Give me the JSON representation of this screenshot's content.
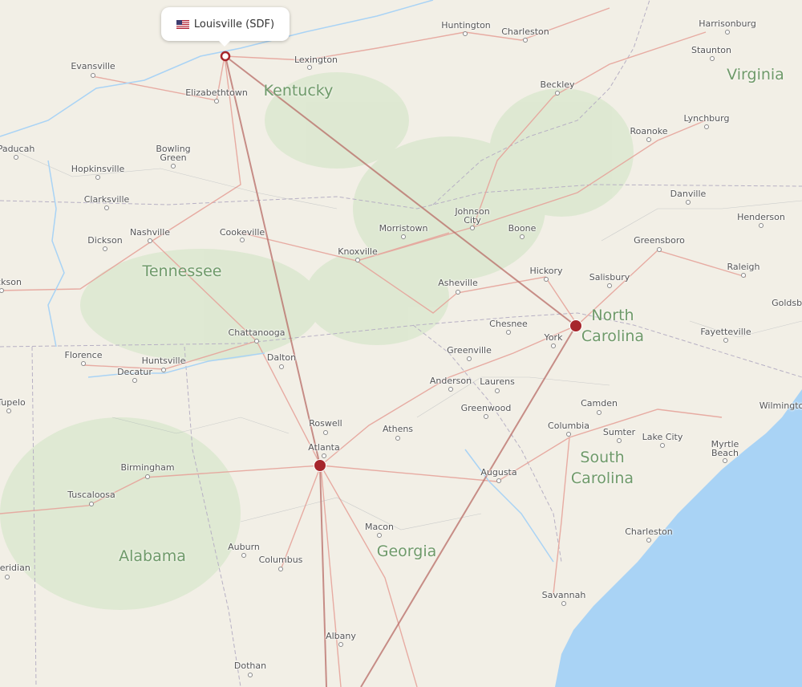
{
  "origin": {
    "label": "Louisville (SDF)",
    "flag": "us-flag-icon"
  },
  "colors": {
    "land": "#f2efe6",
    "water": "#a9d3f5",
    "route": "#b86c66",
    "airport": "#a6262c",
    "state_label": "#6f9a6a"
  },
  "states": [
    "Kentucky",
    "Tennessee",
    "Virginia",
    "North Carolina",
    "South Carolina",
    "Georgia",
    "Alabama"
  ],
  "cities": [
    "Evansville",
    "Louisville",
    "Lexington",
    "Huntington",
    "Charleston",
    "Harrisonburg",
    "Staunton",
    "Beckley",
    "Elizabethtown",
    "Paducah",
    "Bowling Green",
    "Hopkinsville",
    "Clarksville",
    "Roanoke",
    "Lynchburg",
    "Danville",
    "Johnson City",
    "Boone",
    "Morristown",
    "Knoxville",
    "Nashville",
    "Cookeville",
    "Dickson",
    "Henderson",
    "Greensboro",
    "Raleigh",
    "Goldsboro",
    "Hickory",
    "Salisbury",
    "Asheville",
    "Chesnee",
    "York",
    "Chattanooga",
    "Florence",
    "Huntsville",
    "Decatur",
    "Dalton",
    "Greenville",
    "Anderson",
    "Laurens",
    "Fayetteville",
    "Camden",
    "Wilmington",
    "Greenwood",
    "Columbia",
    "Sumter",
    "Lake City",
    "Myrtle Beach",
    "Roswell",
    "Atlanta",
    "Athens",
    "Augusta",
    "Birmingham",
    "Tuscaloosa",
    "Auburn",
    "Columbus",
    "Macon",
    "Charleston",
    "Savannah",
    "Albany",
    "Dothan",
    "Tupelo",
    "Meridian",
    "Jackson"
  ]
}
